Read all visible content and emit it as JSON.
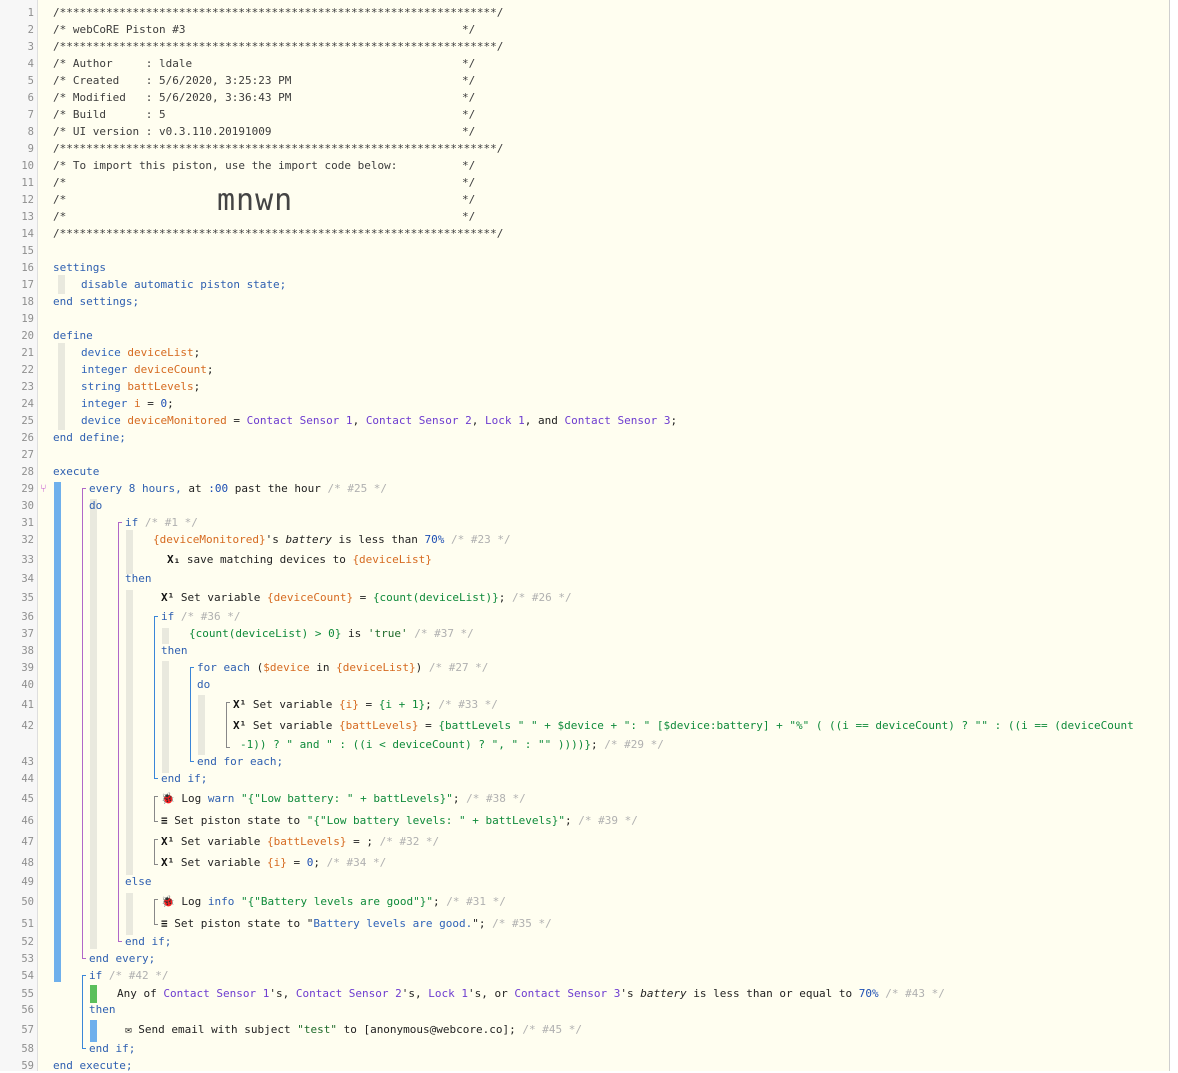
{
  "header": {
    "l1": "/******************************************************************/",
    "l2a": "/* webCoRE Piston #3",
    "l2b": "*/",
    "l3": "/******************************************************************/",
    "l4a": "/* Author     : ldale",
    "l4b": "*/",
    "l5a": "/* Created    : 5/6/2020, 3:25:23 PM",
    "l5b": "*/",
    "l6a": "/* Modified   : 5/6/2020, 3:36:43 PM",
    "l6b": "*/",
    "l7a": "/* Build      : 5",
    "l7b": "*/",
    "l8a": "/* UI version : v0.3.110.20191009",
    "l8b": "*/",
    "l9": "/******************************************************************/",
    "l10a": "/* To import this piston, use the import code below:",
    "l10b": "*/",
    "l11a": "/*",
    "l11b": "*/",
    "l12a": "/*",
    "l12b": "*/",
    "import_code": "mnwn",
    "l13a": "/*",
    "l13b": "*/",
    "l14": "/******************************************************************/"
  },
  "settings": {
    "open": "settings",
    "body": "disable automatic piston state;",
    "close": "end settings;"
  },
  "define": {
    "open": "define",
    "vars": [
      {
        "type": "device",
        "name": "deviceList",
        "end": ";"
      },
      {
        "type": "integer",
        "name": "deviceCount",
        "end": ";"
      },
      {
        "type": "string",
        "name": "battLevels",
        "end": ";"
      },
      {
        "type": "integer",
        "name": "i",
        "assign": " = ",
        "value": "0",
        "end": ";"
      }
    ],
    "monitored": {
      "type": "device",
      "name": "deviceMonitored",
      "assign": " = ",
      "d1": "Contact Sensor 1",
      "sep1": ", ",
      "d2": "Contact Sensor 2",
      "sep2": ", ",
      "d3": "Lock 1",
      "sep3": ", and ",
      "d4": "Contact Sensor 3",
      "end": ";"
    },
    "close": "end define;"
  },
  "execute": {
    "open": "execute",
    "every": {
      "kw": "every",
      "rest": " 8 hours,",
      "at": " at ",
      "time": ":00",
      "tail": " past the hour ",
      "cm": "/* #25 */"
    },
    "do": "do",
    "if1": {
      "kw": "if",
      "cm": " /* #1 */"
    },
    "cond1": {
      "dev": "{deviceMonitored}",
      "mid": "'s ",
      "attr": "battery",
      "rest": " is less than ",
      "val": "70%",
      "cm": " /* #23 */"
    },
    "save": {
      "icon": "X₁",
      "text": " save matching devices to ",
      "var": "{deviceList}"
    },
    "then1": "then",
    "set26": {
      "icon": "X¹",
      "text": " Set variable ",
      "var": "{deviceCount}",
      "eq": " = ",
      "expr": "{count(deviceList)}",
      "end": ";",
      "cm": " /* #26 */"
    },
    "if36": {
      "kw": "if",
      "cm": " /* #36 */"
    },
    "cond37": {
      "expr": "{count(deviceList) > 0}",
      "is": " is ",
      "val": "'true'",
      "cm": " /* #37 */"
    },
    "then36": "then",
    "foreach": {
      "kw": "for each",
      "p1": " (",
      "var": "$device",
      "in": " in ",
      "list": "{deviceList}",
      "p2": ")",
      "cm": " /* #27 */"
    },
    "do27": "do",
    "set33": {
      "icon": "X¹",
      "text": " Set variable ",
      "var": "{i}",
      "eq": " = ",
      "expr": "{i + 1}",
      "end": ";",
      "cm": " /* #33 */"
    },
    "set29a": {
      "icon": "X¹",
      "text": " Set variable ",
      "var": "{battLevels}",
      "eq": " = ",
      "expr": "{battLevels \" \" + $device + \": \" [$device:battery] + \"%\" ( ((i == deviceCount) ? \"\" : ((i == (deviceCount"
    },
    "set29b": {
      "expr": "-1)) ? \" and \" : ((i < deviceCount) ? \", \" : \"\" ))))}",
      "end": ";",
      "cm": " /* #29 */"
    },
    "endfor": "end for each;",
    "endif36": "end if;",
    "log38": {
      "icon": "🐞",
      "text": " Log ",
      "lvl": "warn",
      "sp": " ",
      "val": "\"{\"Low battery: \" + battLevels}\"",
      "end": ";",
      "cm": " /* #38 */"
    },
    "state39": {
      "icon": "≡",
      "text": " Set piston state to ",
      "val": "\"{\"Low battery levels: \" + battLevels}\"",
      "end": ";",
      "cm": " /* #39 */"
    },
    "set32": {
      "icon": "X¹",
      "text": " Set variable ",
      "var": "{battLevels}",
      "eq": " = ;",
      "cm": " /* #32 */"
    },
    "set34": {
      "icon": "X¹",
      "text": " Set variable ",
      "var": "{i}",
      "eq": " = ",
      "val": "0",
      "end": ";",
      "cm": " /* #34 */"
    },
    "else": "else",
    "log31": {
      "icon": "🐞",
      "text": " Log ",
      "lvl": "info",
      "sp": " ",
      "val": "\"{\"Battery levels are good\"}\"",
      "end": ";",
      "cm": " /* #31 */"
    },
    "state35": {
      "icon": "≡",
      "text": " Set piston state to ",
      "q1": "\"",
      "val": "Battery levels are good.",
      "q2": "\"",
      "end": ";",
      "cm": " /* #35 */"
    },
    "endif1": "end if;",
    "endevery": "end every;",
    "if42": {
      "kw": "if",
      "cm": " /* #42 */"
    },
    "cond43": {
      "any": "Any of ",
      "d1": "Contact Sensor 1",
      "s1": "'s, ",
      "d2": "Contact Sensor 2",
      "s2": "'s, ",
      "d3": "Lock 1",
      "s3": "'s, or ",
      "d4": "Contact Sensor 3",
      "s4": "'s ",
      "attr": "battery",
      "rest": " is less than or equal to ",
      "val": "70%",
      "cm": " /* #43 */"
    },
    "then42": "then",
    "email45": {
      "icon": "✉",
      "text": " Send email with subject ",
      "subj": "\"test\"",
      "to": " to [anonymous@webcore.co];",
      "cm": " /* #45 */"
    },
    "endif42": "end if;",
    "close": "end execute;"
  },
  "gutter": [
    "1",
    "2",
    "3",
    "4",
    "5",
    "6",
    "7",
    "8",
    "9",
    "10",
    "11",
    "12",
    "13",
    "14",
    "15",
    "16",
    "17",
    "18",
    "19",
    "20",
    "21",
    "22",
    "23",
    "24",
    "25",
    "26",
    "27",
    "28",
    "29",
    "30",
    "31",
    "32",
    "33",
    "34",
    "35",
    "36",
    "37",
    "38",
    "39",
    "40",
    "41",
    "42",
    "43",
    "44",
    "45",
    "46",
    "47",
    "48",
    "49",
    "50",
    "51",
    "52",
    "53",
    "54",
    "55",
    "56",
    "57",
    "58",
    "59"
  ],
  "fork_icon": "branch-icon"
}
